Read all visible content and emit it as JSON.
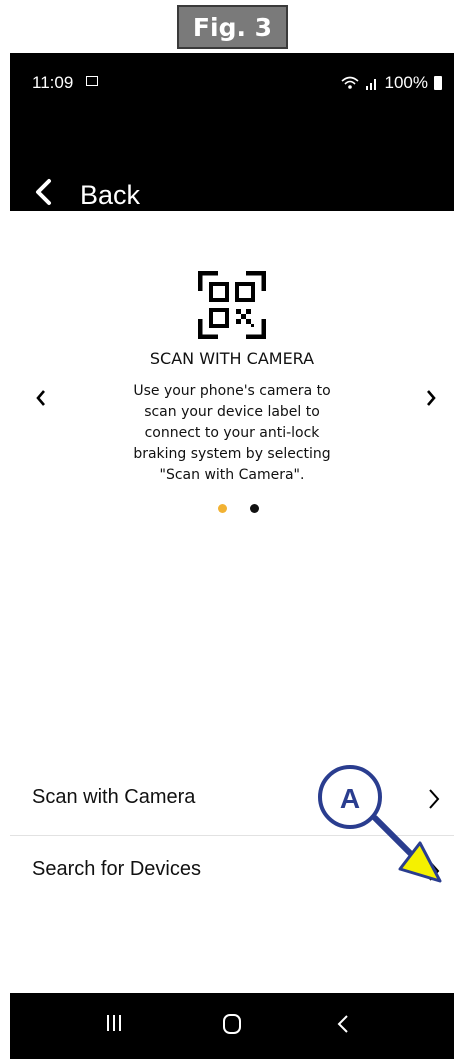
{
  "figure": {
    "label": "Fig. 3"
  },
  "status_bar": {
    "time": "11:09",
    "battery": "100%"
  },
  "header": {
    "back_label": "Back"
  },
  "card": {
    "title": "SCAN WITH CAMERA",
    "body": "Use your phone's camera to scan your device label to connect to your anti-lock braking system by selecting \"Scan with Camera\".",
    "active_page": 1,
    "page_count": 2
  },
  "list": [
    {
      "label": "Scan with Camera"
    },
    {
      "label": "Search for Devices"
    }
  ],
  "callout": {
    "label": "A"
  },
  "colors": {
    "accent_dot": "#f2b233",
    "callout_fill": "#f5f100",
    "callout_stroke": "#2a3d8f"
  },
  "icons": [
    "qr-code-icon",
    "chevron-left-icon",
    "chevron-right-icon",
    "wifi-icon",
    "signal-icon",
    "battery-icon",
    "recents-icon",
    "home-icon",
    "back-nav-icon"
  ]
}
